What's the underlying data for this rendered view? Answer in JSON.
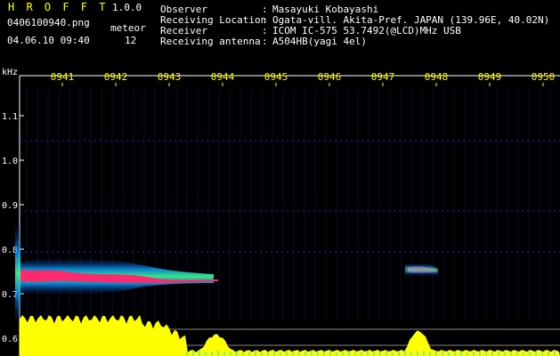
{
  "header": {
    "app_title": "H R O F F T",
    "version": "1.0.0",
    "filename": "0406100940.png",
    "datetime": "04.06.10 09:40",
    "meteor_label": "meteor",
    "meteor_count": "12"
  },
  "info": [
    {
      "label": "Observer",
      "value": "Masayuki Kobayashi"
    },
    {
      "label": "Receiving Location",
      "value": "Ogata-vill. Akita-Pref. JAPAN (139.96E, 40.02N)"
    },
    {
      "label": "Receiver",
      "value": "ICOM IC-575 53.7492(@LCD)MHz USB"
    },
    {
      "label": "Receiving antenna",
      "value": "A504HB(yagi 4el)"
    }
  ],
  "info_separator": ":",
  "axis": {
    "y_unit": "kHz",
    "y_ticks": [
      "1.1",
      "1.0",
      "0.9",
      "0.8",
      "0.7",
      "0.6"
    ],
    "time_ticks": [
      "0941",
      "0942",
      "0943",
      "0944",
      "0945",
      "0946",
      "0947",
      "0948",
      "0949",
      "0950"
    ]
  },
  "colors": {
    "background": "#000000",
    "text_yellow": "#ffff00",
    "text_white": "#ffffff",
    "echo_core": "#ff2a6d",
    "echo_halo": "#00e0ff",
    "noise_line": "#2a3cff",
    "level_fill": "#ffff00"
  }
}
